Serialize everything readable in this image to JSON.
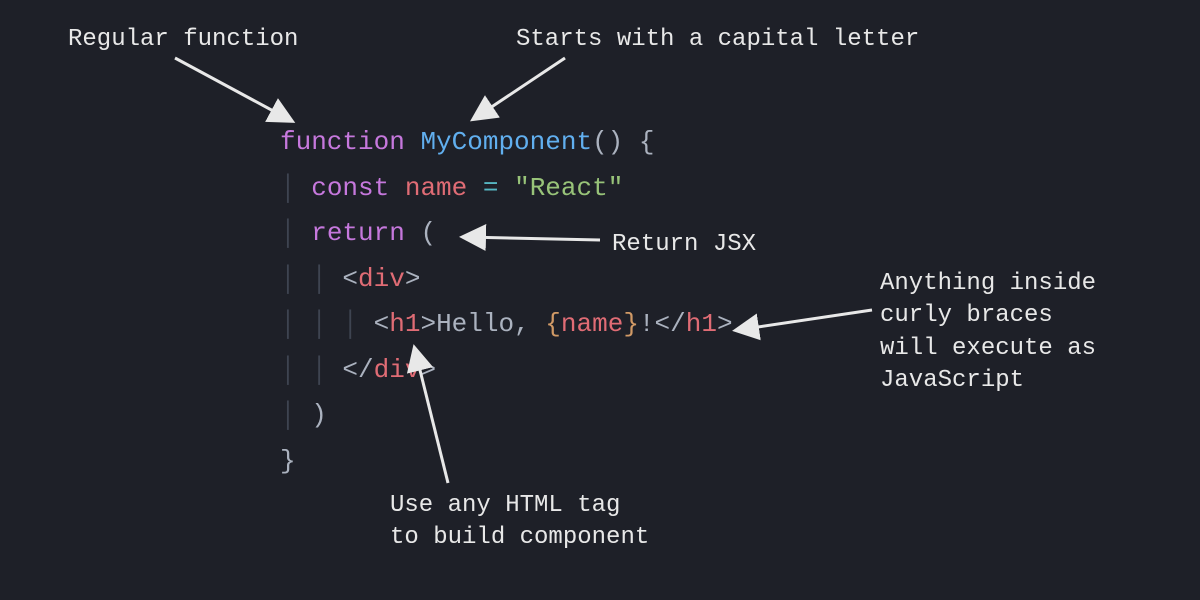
{
  "annotations": {
    "regular_function": "Regular function",
    "capital_letter": "Starts with a capital letter",
    "return_jsx": "Return JSX",
    "curly_braces": "Anything inside\ncurly braces\nwill execute as\nJavaScript",
    "html_tag": "Use any HTML tag\nto build component"
  },
  "code": {
    "kw_function": "function",
    "fn_name": "MyComponent",
    "parens": "()",
    "brace_open": "{",
    "kw_const": "const",
    "var_name": "name",
    "op_eq": "=",
    "str_value": "\"React\"",
    "kw_return": "return",
    "paren_open": "(",
    "tag_div_open": "div",
    "tag_h1": "h1",
    "jsx_hello": "Hello, ",
    "jsx_expr": "name",
    "jsx_bang": "!",
    "tag_div_close": "div",
    "paren_close": ")",
    "brace_close": "}"
  },
  "colors": {
    "bg": "#1e2028",
    "text": "#e8e8e8",
    "keyword": "#c678dd",
    "function": "#61afef",
    "variable": "#e06c75",
    "operator": "#56b6c2",
    "string": "#98c379",
    "default": "#abb2bf",
    "jsx_brace": "#d19a66"
  }
}
